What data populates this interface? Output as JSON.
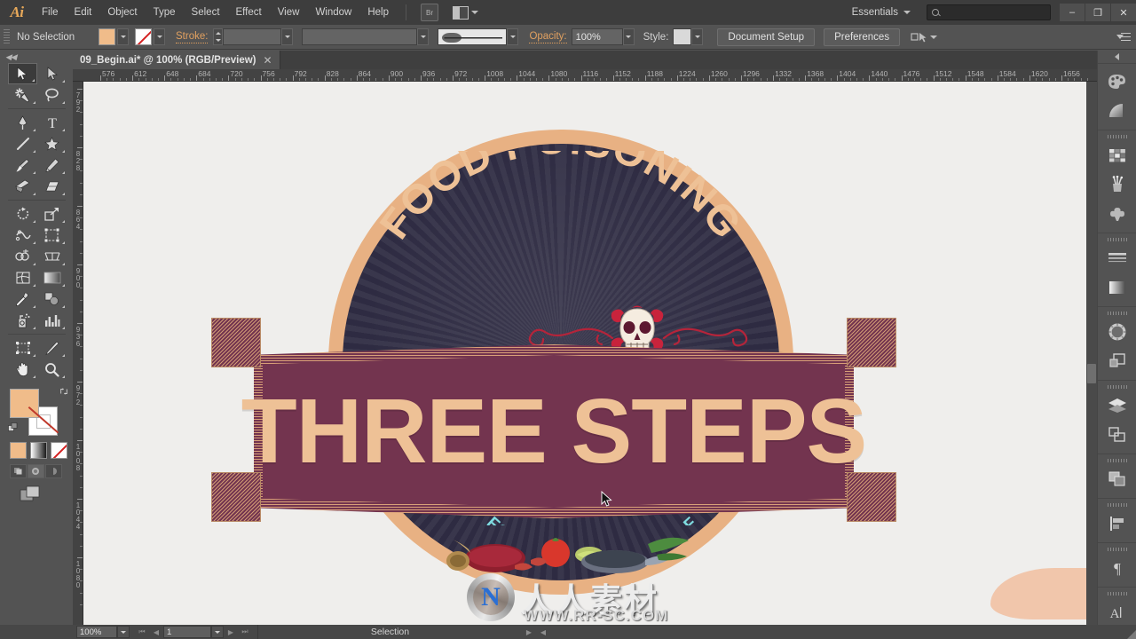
{
  "app": {
    "name": "Adobe Illustrator",
    "logo_text": "Ai"
  },
  "menubar": {
    "items": [
      {
        "label": "File"
      },
      {
        "label": "Edit"
      },
      {
        "label": "Object"
      },
      {
        "label": "Type"
      },
      {
        "label": "Select"
      },
      {
        "label": "Effect"
      },
      {
        "label": "View"
      },
      {
        "label": "Window"
      },
      {
        "label": "Help"
      }
    ],
    "bridge_label": "Br",
    "arrange_documents_label": "",
    "workspace": "Essentials",
    "search_placeholder": "",
    "window_buttons": {
      "minimize": "–",
      "maximize": "❐",
      "close": "✕"
    }
  },
  "controlbar": {
    "selection_status": "No Selection",
    "fill_color": "#f0bc8a",
    "stroke_color": "none",
    "stroke_label": "Stroke:",
    "stroke_weight": "",
    "stroke_profile": "",
    "brush_definition": "",
    "opacity_label": "Opacity:",
    "opacity_value": "100%",
    "style_label": "Style:",
    "document_setup_label": "Document Setup",
    "preferences_label": "Preferences"
  },
  "document_tab": {
    "title": "09_Begin.ai* @ 100% (RGB/Preview)",
    "close_glyph": "✕",
    "modified": true
  },
  "toolbar": {
    "tools": [
      {
        "name": "selection-tool",
        "active": true
      },
      {
        "name": "direct-selection-tool",
        "active": false
      },
      {
        "name": "magic-wand-tool",
        "active": false
      },
      {
        "name": "lasso-tool",
        "active": false
      },
      {
        "name": "pen-tool",
        "active": false
      },
      {
        "name": "type-tool",
        "active": false
      },
      {
        "name": "line-segment-tool",
        "active": false
      },
      {
        "name": "shape-tool",
        "active": false
      },
      {
        "name": "paintbrush-tool",
        "active": false
      },
      {
        "name": "pencil-tool",
        "active": false
      },
      {
        "name": "blob-brush-tool",
        "active": false
      },
      {
        "name": "eraser-tool",
        "active": false
      },
      {
        "name": "rotate-tool",
        "active": false
      },
      {
        "name": "scale-tool",
        "active": false
      },
      {
        "name": "width-tool",
        "active": false
      },
      {
        "name": "free-transform-tool",
        "active": false
      },
      {
        "name": "shape-builder-tool",
        "active": false
      },
      {
        "name": "perspective-grid-tool",
        "active": false
      },
      {
        "name": "mesh-tool",
        "active": false
      },
      {
        "name": "gradient-tool",
        "active": false
      },
      {
        "name": "eyedropper-tool",
        "active": false
      },
      {
        "name": "blend-tool",
        "active": false
      },
      {
        "name": "symbol-sprayer-tool",
        "active": false
      },
      {
        "name": "column-graph-tool",
        "active": false
      },
      {
        "name": "artboard-tool",
        "active": false
      },
      {
        "name": "slice-tool",
        "active": false
      },
      {
        "name": "hand-tool",
        "active": false
      },
      {
        "name": "zoom-tool",
        "active": false
      }
    ],
    "fill_color": "#f0bc8a",
    "stroke_color": "#ffffff",
    "color_modes": [
      "color",
      "gradient",
      "none"
    ],
    "draw_modes": [
      "draw-normal",
      "draw-behind",
      "draw-inside"
    ],
    "screen_mode": "change-screen-mode"
  },
  "rulers": {
    "units": "px",
    "horizontal_labels": [
      "576",
      "612",
      "648",
      "684",
      "720",
      "756",
      "792",
      "828",
      "864",
      "900",
      "936",
      "972",
      "1008",
      "1044",
      "1080",
      "1116",
      "1152",
      "1188",
      "1224",
      "1260",
      "1296",
      "1332",
      "1368",
      "1404",
      "1440",
      "1476",
      "1512",
      "1548",
      "1584",
      "1620",
      "1656"
    ],
    "vertical_labels": [
      "792",
      "828",
      "864",
      "900",
      "936",
      "972",
      "1008",
      "1044",
      "1080"
    ]
  },
  "dock": {
    "panels": [
      {
        "name": "color-panel",
        "icon": "palette-icon"
      },
      {
        "name": "color-guide-panel",
        "icon": "quarter-circle-icon"
      },
      {
        "name": "swatches-panel",
        "icon": "swatches-grid-icon"
      },
      {
        "name": "brushes-panel",
        "icon": "brush-jar-icon"
      },
      {
        "name": "symbols-panel",
        "icon": "clover-icon"
      },
      {
        "name": "stroke-panel",
        "icon": "stroke-lines-icon"
      },
      {
        "name": "gradient-panel",
        "icon": "gradient-icon"
      },
      {
        "name": "transparency-panel",
        "icon": "checker-circle-icon"
      },
      {
        "name": "appearance-panel",
        "icon": "overlapping-squares-icon"
      },
      {
        "name": "layers-panel",
        "icon": "layers-icon"
      },
      {
        "name": "artboards-panel",
        "icon": "artboards-icon"
      },
      {
        "name": "pathfinder-panel",
        "icon": "pathfinder-icon"
      },
      {
        "name": "align-panel",
        "icon": "align-icon"
      },
      {
        "name": "paragraph-panel",
        "icon": "paragraph-icon"
      },
      {
        "name": "character-panel",
        "icon": "character-icon"
      }
    ]
  },
  "statusbar": {
    "zoom_level": "100%",
    "artboard_number": "1",
    "tool_status": "Selection",
    "nav_first": "⏮",
    "nav_prev": "◀",
    "nav_next": "▶",
    "nav_last": "⏭"
  },
  "artwork": {
    "title_arc": "FOOD POISONING",
    "main_banner": "THREE STEPS",
    "sub_banner": "FOR THE PREVENTION OF",
    "colors": {
      "badge_rim": "#e8b183",
      "badge_field": "#2e2b42",
      "ribbon": "#73344f",
      "ribbon_text": "#eec196",
      "sub_ribbon": "#e8807e",
      "sub_ribbon_text": "#7fdbe0",
      "canvas": "#efeeec"
    },
    "elements": [
      {
        "name": "sugar-skull-illustration"
      },
      {
        "name": "red-flourish-ornament"
      },
      {
        "name": "food-ingredients-illustration"
      },
      {
        "name": "ornate-ribbon-frame"
      }
    ]
  },
  "watermark": {
    "site_cn": "人人素材",
    "site_url": "WWW.RR-SC.COM",
    "logo_mark": "N"
  }
}
